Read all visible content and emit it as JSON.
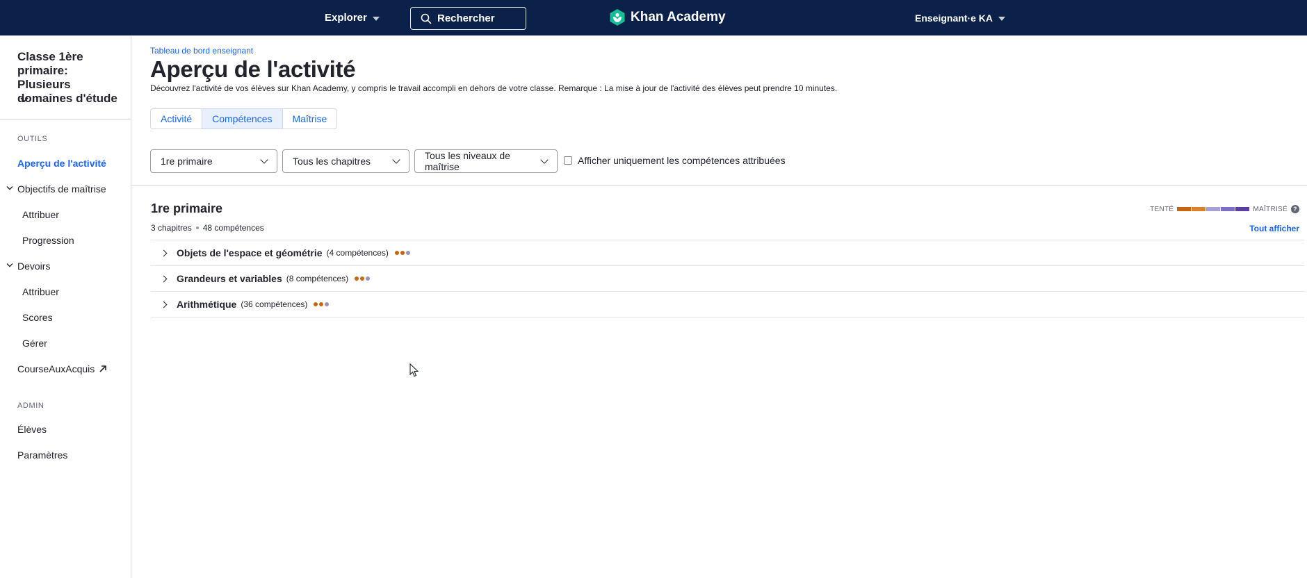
{
  "topbar": {
    "explore_label": "Explorer",
    "search_placeholder": "Rechercher",
    "logo_text": "Khan Academy",
    "user_label": "Enseignant·e KA"
  },
  "sidebar": {
    "class_title": "Classe 1ère primaire: Plusieurs domaines d'étude",
    "tools_section": "OUTILS",
    "items": [
      {
        "label": "Aperçu de l'activité"
      },
      {
        "label": "Objectifs de maîtrise"
      },
      {
        "label": "Attribuer"
      },
      {
        "label": "Progression"
      },
      {
        "label": "Devoirs"
      },
      {
        "label": "Attribuer"
      },
      {
        "label": "Scores"
      },
      {
        "label": "Gérer"
      },
      {
        "label": "CourseAuxAcquis"
      }
    ],
    "admin_section": "ADMIN",
    "admin_items": [
      {
        "label": "Élèves"
      },
      {
        "label": "Paramètres"
      }
    ]
  },
  "main": {
    "breadcrumb": "Tableau de bord enseignant",
    "title": "Aperçu de l'activité",
    "description": "Découvrez l'activité de vos élèves sur Khan Academy, y compris le travail accompli en dehors de votre classe. Remarque : La mise à jour de l'activité des élèves peut prendre 10 minutes.",
    "tabs": [
      {
        "label": "Activité"
      },
      {
        "label": "Compétences"
      },
      {
        "label": "Maîtrise"
      }
    ],
    "selected_tab": "Compétences",
    "filters": {
      "grade": "1re primaire",
      "chapters": "Tous les chapitres",
      "mastery": "Tous les niveaux de maîtrise",
      "assigned_only_label": "Afficher uniquement les compétences attribuées",
      "assigned_only_checked": false
    },
    "grade_section": {
      "title": "1re primaire",
      "chapters_count": "3 chapitres",
      "skills_count": "48 compétences",
      "legend_start": "TENTÉ",
      "legend_end": "MAÎTRISÉ",
      "legend_colors": [
        "#c8650f",
        "#d9822b",
        "#a79fd6",
        "#7a6ec7",
        "#5b3ea1"
      ],
      "show_all": "Tout afficher"
    },
    "chapters": [
      {
        "name": "Objets de l'espace et géométrie",
        "count": "(4 compétences)",
        "dot_colors": [
          "#c8650f",
          "#c8650f",
          "#9a93b8"
        ]
      },
      {
        "name": "Grandeurs et variables",
        "count": "(8 compétences)",
        "dot_colors": [
          "#c8650f",
          "#c8650f",
          "#9a93b8"
        ]
      },
      {
        "name": "Arithmétique",
        "count": "(36 compétences)",
        "dot_colors": [
          "#c8650f",
          "#c8650f",
          "#9a93b8"
        ]
      }
    ]
  }
}
